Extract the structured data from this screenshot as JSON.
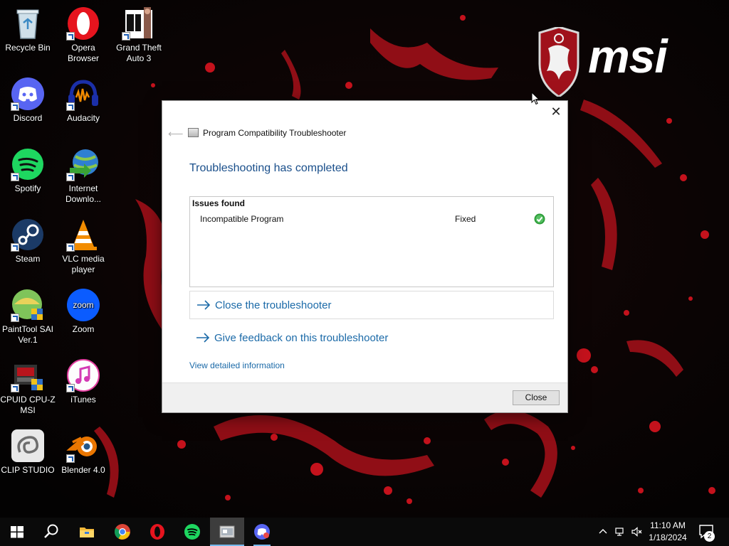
{
  "wallpaper": {
    "brand": "msi",
    "accent": "#b4121a"
  },
  "desktop_icons": [
    {
      "label": "Recycle Bin",
      "icon": "recycle-bin-icon"
    },
    {
      "label": "Opera Browser",
      "icon": "opera-icon"
    },
    {
      "label": "Grand Theft Auto 3",
      "icon": "gta3-icon"
    },
    {
      "label": "Discord",
      "icon": "discord-icon"
    },
    {
      "label": "Audacity",
      "icon": "audacity-icon"
    },
    {
      "label": "Spotify",
      "icon": "spotify-icon"
    },
    {
      "label": "Internet Downlo...",
      "icon": "internet-download-manager-icon"
    },
    {
      "label": "Steam",
      "icon": "steam-icon"
    },
    {
      "label": "VLC media player",
      "icon": "vlc-icon"
    },
    {
      "label": "PaintTool SAI Ver.1",
      "icon": "painttool-sai-icon"
    },
    {
      "label": "Zoom",
      "icon": "zoom-icon"
    },
    {
      "label": "CPUID CPU-Z MSI",
      "icon": "cpu-z-icon"
    },
    {
      "label": "iTunes",
      "icon": "itunes-icon"
    },
    {
      "label": "CLIP STUDIO",
      "icon": "clip-studio-icon"
    },
    {
      "label": "Blender 4.0",
      "icon": "blender-icon"
    }
  ],
  "dialog": {
    "title": "Program Compatibility Troubleshooter",
    "heading": "Troubleshooting has completed",
    "issues_header": "Issues found",
    "issues": [
      {
        "name": "Incompatible Program",
        "status": "Fixed"
      }
    ],
    "close_link": "Close the troubleshooter",
    "feedback_link": "Give feedback on this troubleshooter",
    "details_link": "View detailed information",
    "close_button": "Close",
    "link_color": "#1b6aa8",
    "heading_color": "#1a4f8b"
  },
  "taskbar": {
    "items": [
      "start-icon",
      "search-icon",
      "file-explorer-icon",
      "chrome-icon",
      "opera-icon",
      "spotify-icon",
      "troubleshooter-icon",
      "discord-icon"
    ],
    "time": "11:10 AM",
    "date": "1/18/2024",
    "notification_count": "2"
  }
}
